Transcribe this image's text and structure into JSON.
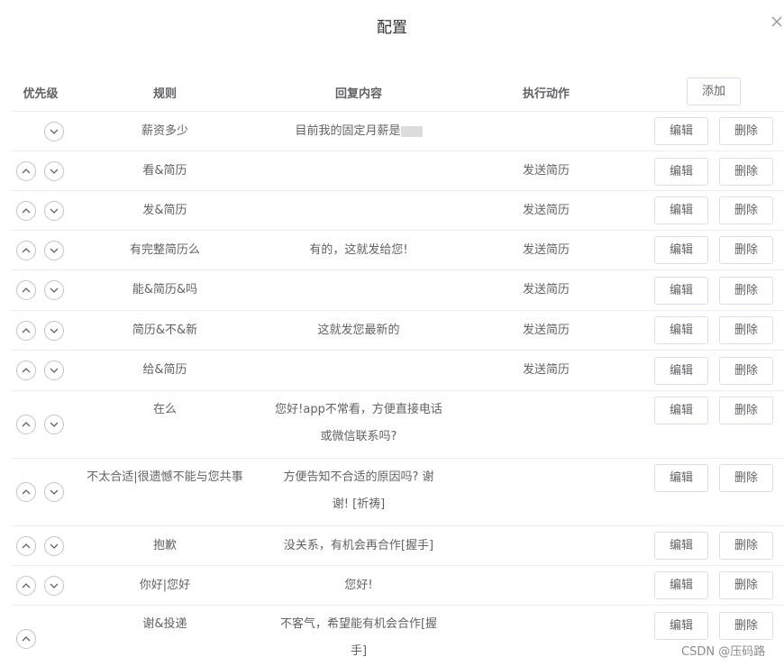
{
  "dialog": {
    "title": "配置"
  },
  "table": {
    "headers": {
      "priority": "优先级",
      "rule": "规则",
      "reply": "回复内容",
      "action": "执行动作"
    },
    "add_label": "添加",
    "edit_label": "编辑",
    "delete_label": "删除",
    "rows": [
      {
        "rule": "薪资多少",
        "reply": "目前我的固定月薪是",
        "action": ""
      },
      {
        "rule": "看&简历",
        "reply": "",
        "action": "发送简历"
      },
      {
        "rule": "发&简历",
        "reply": "",
        "action": "发送简历"
      },
      {
        "rule": "有完整简历么",
        "reply": "有的，这就发给您!",
        "action": "发送简历"
      },
      {
        "rule": "能&简历&吗",
        "reply": "",
        "action": "发送简历"
      },
      {
        "rule": "简历&不&新",
        "reply": "这就发您最新的",
        "action": "发送简历"
      },
      {
        "rule": "给&简历",
        "reply": "",
        "action": "发送简历"
      },
      {
        "rule": "在么",
        "reply_line1": "您好!app不常看，方便直接电话",
        "reply_line2": "或微信联系吗?",
        "action": ""
      },
      {
        "rule": "不太合适|很遗憾不能与您共事",
        "reply_line1": "方便告知不合适的原因吗? 谢",
        "reply_line2": "谢! [祈祷]",
        "action": ""
      },
      {
        "rule": "抱歉",
        "reply": "没关系，有机会再合作[握手]",
        "action": ""
      },
      {
        "rule": "你好|您好",
        "reply": "您好!",
        "action": ""
      },
      {
        "rule": "谢&投递",
        "reply_line1": "不客气，希望能有机会合作[握",
        "reply_line2": "手]",
        "action": ""
      }
    ]
  },
  "icons": {
    "close": "close-icon",
    "up": "chevron-up-icon",
    "down": "chevron-down-icon"
  },
  "watermark": "CSDN @压码路"
}
